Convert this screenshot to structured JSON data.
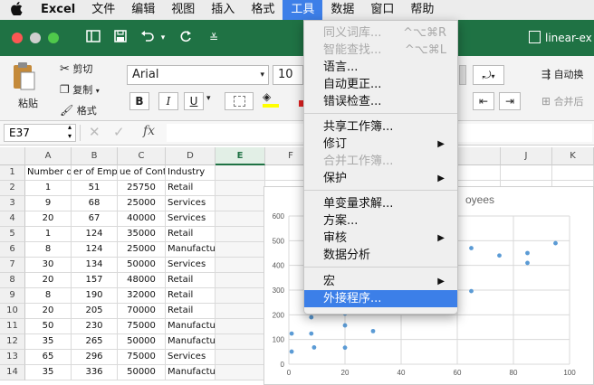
{
  "menubar": {
    "apple": "",
    "app": "Excel",
    "items": [
      "文件",
      "编辑",
      "视图",
      "插入",
      "格式",
      "工具",
      "数据",
      "窗口",
      "帮助"
    ],
    "active_index": 5
  },
  "titlebar": {
    "filename": "linear-ex"
  },
  "ribbon": {
    "paste": "粘贴",
    "cut": "剪切",
    "copy": "复制",
    "format_painter": "格式",
    "font_name": "Arial",
    "font_size": "10",
    "bold": "B",
    "italic": "I",
    "underline": "U",
    "autowrap": "自动换",
    "merge": "合并后"
  },
  "formula_bar": {
    "name_box": "E37",
    "fx": "fx"
  },
  "columns": [
    "A",
    "B",
    "C",
    "D",
    "E",
    "F",
    "G",
    "H",
    "I",
    "J",
    "K",
    "L"
  ],
  "selected_column": "E",
  "rows": [
    [
      "Number of",
      "er of Emplo",
      "ue of Contra",
      "Industry"
    ],
    [
      "1",
      "51",
      "25750",
      "Retail"
    ],
    [
      "9",
      "68",
      "25000",
      "Services"
    ],
    [
      "20",
      "67",
      "40000",
      "Services"
    ],
    [
      "1",
      "124",
      "35000",
      "Retail"
    ],
    [
      "8",
      "124",
      "25000",
      "Manufacturing"
    ],
    [
      "30",
      "134",
      "50000",
      "Services"
    ],
    [
      "20",
      "157",
      "48000",
      "Retail"
    ],
    [
      "8",
      "190",
      "32000",
      "Retail"
    ],
    [
      "20",
      "205",
      "70000",
      "Retail"
    ],
    [
      "50",
      "230",
      "75000",
      "Manufacturing"
    ],
    [
      "35",
      "265",
      "50000",
      "Manufacturing"
    ],
    [
      "65",
      "296",
      "75000",
      "Services"
    ],
    [
      "35",
      "336",
      "50000",
      "Manufacturing"
    ]
  ],
  "row_numbers": [
    "1",
    "2",
    "3",
    "4",
    "5",
    "6",
    "7",
    "8",
    "9",
    "10",
    "11",
    "12",
    "13",
    "14"
  ],
  "chart": {
    "title_fragment": "oyees"
  },
  "chart_data": {
    "type": "scatter",
    "title": "oyees",
    "x": [
      1,
      9,
      20,
      1,
      8,
      30,
      20,
      8,
      20,
      50,
      35,
      65,
      35,
      75,
      85,
      85,
      95,
      65
    ],
    "y": [
      51,
      68,
      67,
      124,
      124,
      134,
      157,
      190,
      205,
      230,
      265,
      296,
      336,
      440,
      450,
      410,
      490,
      470
    ],
    "xlim": [
      0,
      100
    ],
    "ylim": [
      0,
      600
    ],
    "xticks": [
      "0",
      "20",
      "40",
      "60",
      "80",
      "100"
    ],
    "yticks": [
      "0",
      "100",
      "200",
      "300",
      "400",
      "500",
      "600"
    ],
    "color": "#5b9bd5",
    "grid": true
  },
  "tools_menu": {
    "items": [
      {
        "label": "同义词库...",
        "shortcut": "^⌥⌘R",
        "disabled": true
      },
      {
        "label": "智能查找...",
        "shortcut": "^⌥⌘L",
        "disabled": true
      },
      {
        "label": "语言...",
        "shortcut": "",
        "disabled": false
      },
      {
        "label": "自动更正...",
        "shortcut": "",
        "disabled": false
      },
      {
        "label": "错误检查...",
        "shortcut": "",
        "disabled": false
      },
      {
        "label": "共享工作簿...",
        "shortcut": "",
        "disabled": false
      },
      {
        "label": "修订",
        "shortcut": "",
        "disabled": false,
        "submenu": true
      },
      {
        "label": "合并工作簿...",
        "shortcut": "",
        "disabled": true
      },
      {
        "label": "保护",
        "shortcut": "",
        "disabled": false,
        "submenu": true
      },
      {
        "label": "单变量求解...",
        "shortcut": "",
        "disabled": false
      },
      {
        "label": "方案...",
        "shortcut": "",
        "disabled": false
      },
      {
        "label": "审核",
        "shortcut": "",
        "disabled": false,
        "submenu": true
      },
      {
        "label": "数据分析",
        "shortcut": "",
        "disabled": false
      },
      {
        "label": "宏",
        "shortcut": "",
        "disabled": false,
        "submenu": true
      },
      {
        "label": "外接程序...",
        "shortcut": "",
        "disabled": false,
        "highlighted": true
      }
    ]
  }
}
